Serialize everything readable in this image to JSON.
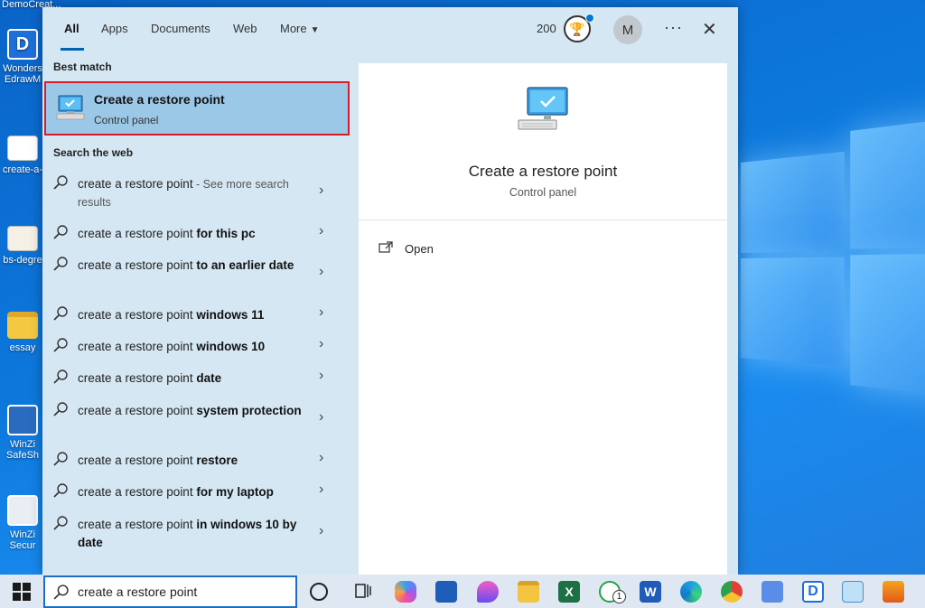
{
  "desktop": {
    "icons": [
      {
        "label": "Wonders\nEdrawM",
        "icon": "edraw-app-icon"
      },
      {
        "label": "create-a-",
        "icon": "document-thumbnail-icon"
      },
      {
        "label": "bs-degre",
        "icon": "certificate-thumbnail-icon"
      },
      {
        "label": "essay",
        "icon": "folder-icon"
      },
      {
        "label": "WinZi\nSafeSh",
        "icon": "winzip-share-icon"
      },
      {
        "label": "WinZi\nSecur",
        "icon": "winzip-secure-icon"
      }
    ],
    "top_label": "DemoCreat..."
  },
  "search_panel": {
    "tabs": [
      {
        "label": "All",
        "active": true
      },
      {
        "label": "Apps"
      },
      {
        "label": "Documents"
      },
      {
        "label": "Web"
      },
      {
        "label": "More"
      }
    ],
    "rewards_points": "200",
    "avatar_initial": "M",
    "more_options": "···",
    "close": "✕",
    "best_match_label": "Best match",
    "best_match": {
      "title": "Create a restore point",
      "subtitle": "Control panel"
    },
    "search_web_label": "Search the web",
    "web_results": [
      {
        "prefix": "create a restore point",
        "bold": "",
        "suffix": " - See more search results"
      },
      {
        "prefix": "create a restore point ",
        "bold": "for this pc",
        "suffix": ""
      },
      {
        "prefix": "create a restore point ",
        "bold": "to an earlier date",
        "suffix": ""
      },
      {
        "prefix": "create a restore point ",
        "bold": "windows 11",
        "suffix": ""
      },
      {
        "prefix": "create a restore point ",
        "bold": "windows 10",
        "suffix": ""
      },
      {
        "prefix": "create a restore point ",
        "bold": "date",
        "suffix": ""
      },
      {
        "prefix": "create a restore point ",
        "bold": "system protection",
        "suffix": ""
      },
      {
        "prefix": "create a restore point ",
        "bold": "restore",
        "suffix": ""
      },
      {
        "prefix": "create a restore point ",
        "bold": "for my laptop",
        "suffix": ""
      },
      {
        "prefix": "create a restore point ",
        "bold": "in windows 10 by date",
        "suffix": ""
      }
    ],
    "detail": {
      "title": "Create a restore point",
      "subtitle": "Control panel",
      "open_label": "Open"
    }
  },
  "taskbar": {
    "search_value": "create a restore point",
    "pinned": [
      "task-view",
      "copilot",
      "store",
      "edge-dev",
      "file-explorer",
      "excel",
      "whatsapp",
      "word",
      "edge",
      "chrome",
      "paint",
      "edraw",
      "system-info",
      "app"
    ],
    "whatsapp_badge": "1"
  }
}
